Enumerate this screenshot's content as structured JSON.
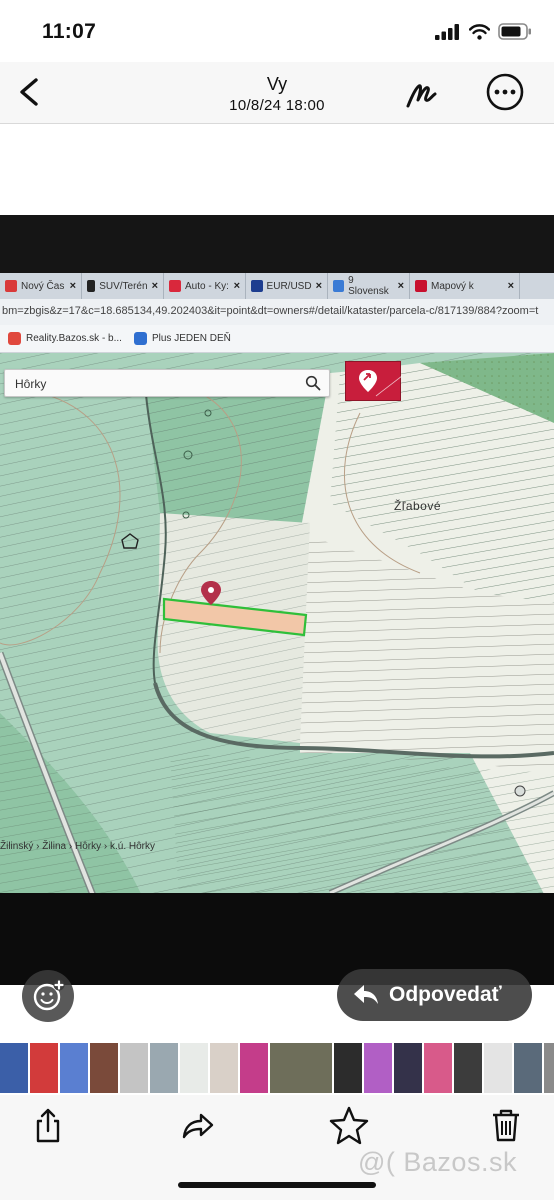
{
  "status_bar": {
    "time": "11:07"
  },
  "header": {
    "title": "Vy",
    "subtitle": "10/8/24 18:00",
    "back_icon": "chevron-left-icon",
    "markup_icon": "markup-pen-icon",
    "more_icon": "ellipsis-circle-icon"
  },
  "photo": {
    "browser_tabs": [
      {
        "label": "Nový Čas",
        "color": "#d93a3a"
      },
      {
        "label": "SUV/Terén",
        "color": "#222222"
      },
      {
        "label": "Auto - Ky:",
        "color": "#d9283c"
      },
      {
        "label": "EUR/USD",
        "color": "#1d3d8f"
      },
      {
        "label": "9 Slovensk",
        "color": "#3a7bd5"
      },
      {
        "label": "Mapový k",
        "color": "#c8102e"
      }
    ],
    "url": "bm=zbgis&z=17&c=18.685134,49.202403&it=point&dt=owners#/detail/kataster/parcela-c/817139/884?zoom=t",
    "bookmarks": [
      {
        "label": "Reality.Bazos.sk - b...",
        "color": "#e0483d"
      },
      {
        "label": "Plus JEDEN DEŇ",
        "color": "#2f6fd0"
      }
    ],
    "map": {
      "search_value": "Hôrky",
      "place_label": "Žľabové",
      "breadcrumb": "Žilinský › Žilina › Hôrky › k.ú. Hôrky"
    }
  },
  "actions": {
    "reply_label": "Odpovedať",
    "reply_icon": "reply-arrow-icon",
    "emoji_icon": "add-reaction-icon"
  },
  "filmstrip": {
    "thumbs": [
      "#3b5fa8",
      "#d23b3b",
      "#5a7fd1",
      "#7a4a3a",
      "#c4c4c4",
      "#9aa8b0",
      "#e8ebe8",
      "#d9d0c8",
      "#c43d8a",
      "#6e6e5a",
      "#2c2c2c",
      "#b15fc5",
      "#34324a",
      "#d85a8a",
      "#3c3c3c",
      "#e4e4e4",
      "#5a6a7a",
      "#8a8a8a"
    ]
  },
  "toolbar": {
    "share_icon": "share-icon",
    "forward_icon": "forward-arrow-icon",
    "star_icon": "star-icon",
    "trash_icon": "trash-icon"
  },
  "watermark": "@( Bazos.sk"
}
